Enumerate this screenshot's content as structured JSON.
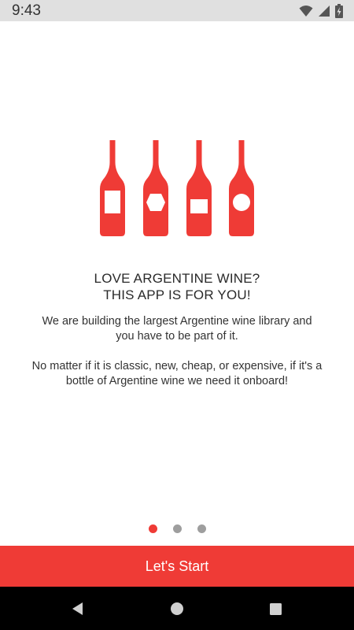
{
  "status_bar": {
    "time": "9:43",
    "icons": [
      "wifi-icon",
      "signal-icon",
      "battery-icon"
    ]
  },
  "illustration": {
    "bottles": [
      {
        "label_shape": "rectangle"
      },
      {
        "label_shape": "hexagon"
      },
      {
        "label_shape": "square"
      },
      {
        "label_shape": "circle"
      }
    ],
    "color": "#ef3b36"
  },
  "onboarding": {
    "headline_line1": "LOVE ARGENTINE WINE?",
    "headline_line2": "THIS APP IS FOR YOU!",
    "paragraph1": "We are building the largest Argentine wine library and you have to be part of it.",
    "paragraph2": "No matter if it is classic, new, cheap, or expensive, if it's a bottle of Argentine wine we need it onboard!",
    "page_count": 3,
    "current_page": 1
  },
  "start_button": {
    "label": "Let's Start"
  },
  "nav_bar": {
    "buttons": [
      "back-icon",
      "home-icon",
      "recents-icon"
    ]
  },
  "colors": {
    "accent": "#ef3b36",
    "status_bar_bg": "#e0e0e0",
    "dot_inactive": "#9e9e9e"
  }
}
